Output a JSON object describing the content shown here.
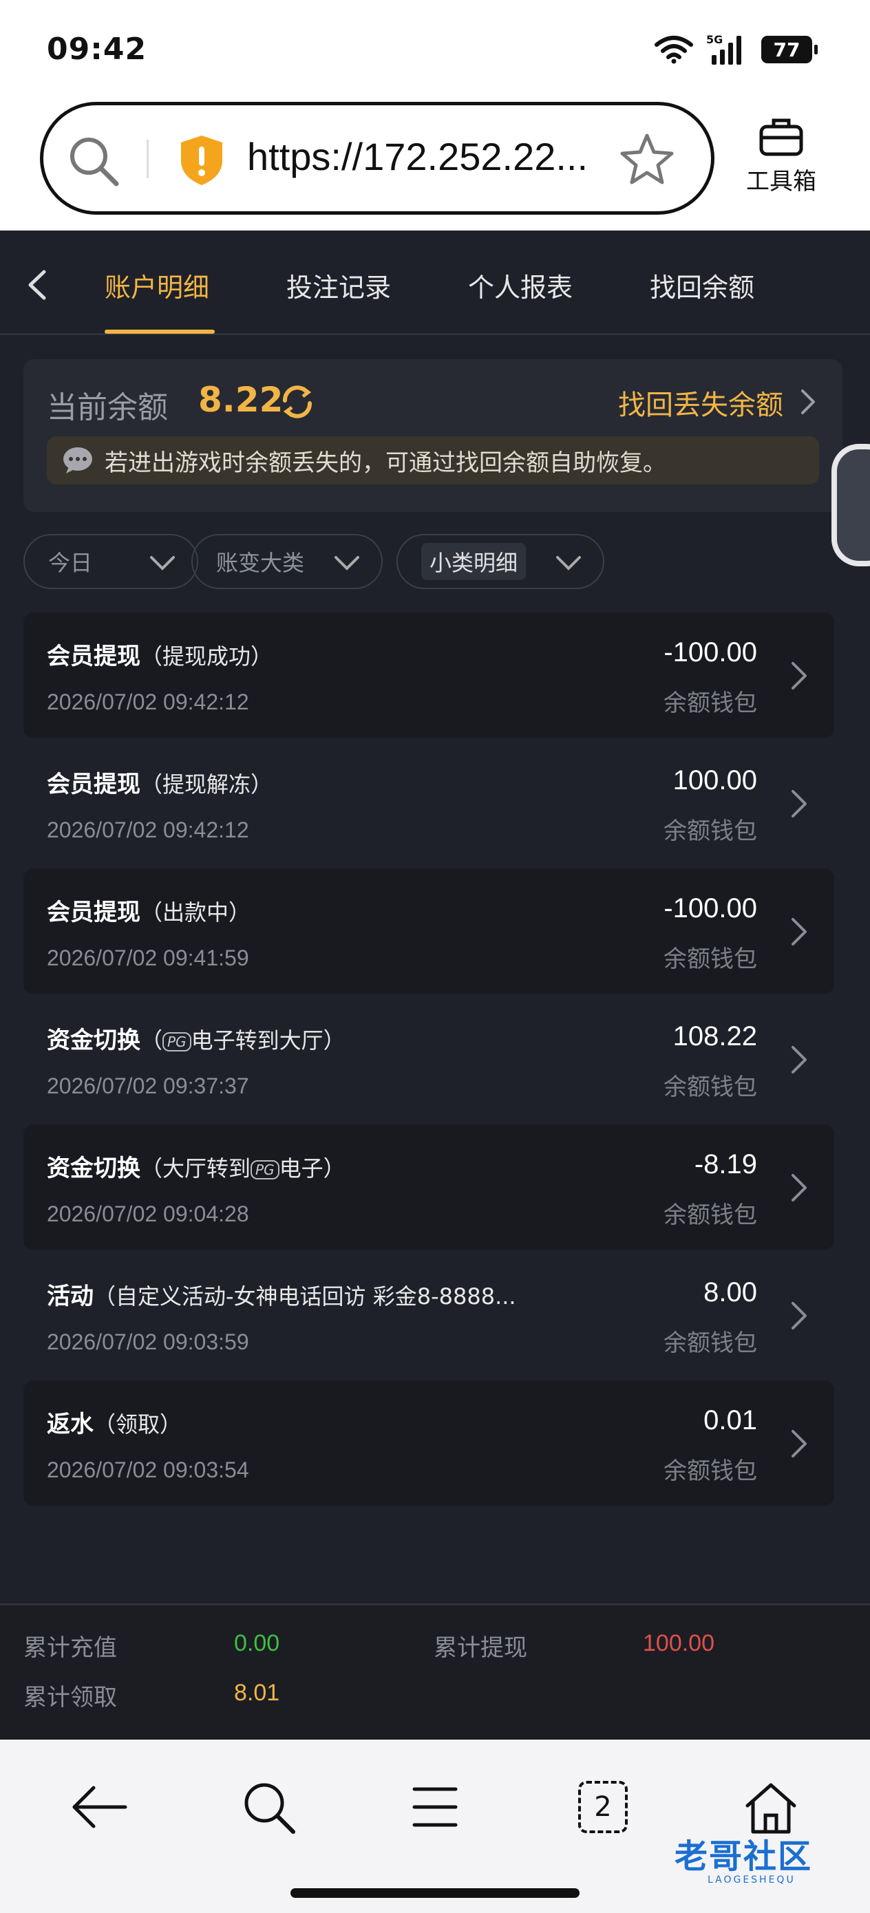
{
  "status_bar": {
    "time": "09:42",
    "network": "5G",
    "battery": "77"
  },
  "browser": {
    "url": "https://172.252.22...",
    "toolbox_label": "工具箱"
  },
  "tabs": [
    "账户明细",
    "投注记录",
    "个人报表",
    "找回余额"
  ],
  "balance": {
    "label": "当前余额",
    "value": "8.22",
    "recover_link": "找回丢失余额",
    "notice": "若进出游戏时余额丢失的，可通过找回余额自助恢复。"
  },
  "filters": [
    "今日",
    "账变大类",
    "小类明细"
  ],
  "records": [
    {
      "title": "会员提现",
      "sub": "（提现成功）",
      "date": "2026/07/02 09:42:12",
      "amount": "-100.00",
      "wallet": "余额钱包"
    },
    {
      "title": "会员提现",
      "sub": "（提现解冻）",
      "date": "2026/07/02 09:42:12",
      "amount": "100.00",
      "wallet": "余额钱包"
    },
    {
      "title": "会员提现",
      "sub": "（出款中）",
      "date": "2026/07/02 09:41:59",
      "amount": "-100.00",
      "wallet": "余额钱包"
    },
    {
      "title": "资金切换",
      "sub_pre": "（",
      "pg": "PG",
      "sub_post": "电子转到大厅）",
      "date": "2026/07/02 09:37:37",
      "amount": "108.22",
      "wallet": "余额钱包"
    },
    {
      "title": "资金切换",
      "sub_pre": "（大厅转到",
      "pg": "PG",
      "sub_post": "电子）",
      "date": "2026/07/02 09:04:28",
      "amount": "-8.19",
      "wallet": "余额钱包"
    },
    {
      "title": "活动",
      "sub": "（自定义活动-女神电话回访 彩金8-8888...",
      "date": "2026/07/02 09:03:59",
      "amount": "8.00",
      "wallet": "余额钱包"
    },
    {
      "title": "返水",
      "sub": "（领取）",
      "date": "2026/07/02 09:03:54",
      "amount": "0.01",
      "wallet": "余额钱包"
    }
  ],
  "totals": {
    "deposit_label": "累计充值",
    "deposit_value": "0.00",
    "withdraw_label": "累计提现",
    "withdraw_value": "100.00",
    "claim_label": "累计领取",
    "claim_value": "8.01"
  },
  "nav": {
    "tab_count": "2"
  },
  "watermark": {
    "title": "老哥社区",
    "sub": "LAOGESHEQU"
  },
  "colors": {
    "accent": "#f2b545",
    "positive": "#3fbf3f",
    "negative": "#e0504a"
  }
}
